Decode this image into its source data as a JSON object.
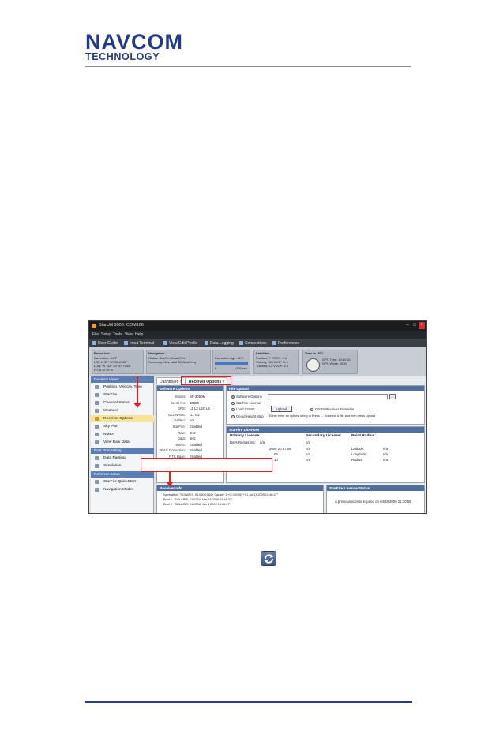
{
  "header": {
    "logo_main": "NAVCOM",
    "logo_sub": "TECHNOLOGY"
  },
  "colors": {
    "brand": "#243a8c",
    "highlight": "#e02020",
    "panel_header": "#4f6f9f"
  },
  "screenshot": {
    "window_title": "StarUtil 3000: COM106",
    "menu": [
      "File",
      "Setup",
      "Tools",
      "View",
      "Help"
    ],
    "toolbar": [
      "User Guide",
      "Input Terminal",
      "View/Edit Profile",
      "Data Logging",
      "Connections",
      "Preferences"
    ],
    "status": {
      "rover_info": {
        "title": "Rover Info",
        "line1": "Correction: NCT",
        "line2": "LAT: N 33° 50' 28.2388\"",
        "line3": "LON: W 118° 20' 37.7934\"",
        "line4": "HT: 6.9779 m"
      },
      "navigation": {
        "title": "Navigation",
        "line1": "Status: StarFire Dual 67%",
        "line2": "Summary: Nav-valid 3D DualFreq",
        "line3": "Correction Age: 82.0",
        "line4": "0",
        "line5": "1200 sec"
      },
      "satellites": {
        "title": "Satellites",
        "line1": "Position: 7    PDOP: 2.6",
        "line2": "Velocity: 11   HDOP: 0.9",
        "line3": "Tracked: 13    VDOP: 2.0"
      },
      "time": {
        "title": "Time in UTC",
        "line1": "GPS Time: 10:40:21",
        "line2": "GPS Week: 1500"
      }
    },
    "sidebar": {
      "detailed_views_title": "Detailed Views",
      "detailed_views": [
        "Position, Velocity, Time",
        "StarFire",
        "Channel Status",
        "Measure",
        "Receiver Options",
        "Sky Plot",
        "NMEA",
        "View Raw Data"
      ],
      "post_processing_title": "Post Processing",
      "post_processing": [
        "Data Parsing",
        "Simulation"
      ],
      "receiver_setup_title": "Receiver Setup",
      "receiver_setup": [
        "StarFire QuickStart",
        "Navigation Modes"
      ]
    },
    "tabs": {
      "dashboard": "Dashboard",
      "receiver_options": "Receiver Options"
    },
    "software_options": {
      "title": "Software Options",
      "rows": [
        {
          "label": "Model:",
          "value": "SF-3050M"
        },
        {
          "label": "Serial No:",
          "value": "30006"
        },
        {
          "label": "GPS:",
          "value": "L1 L2 L2C L5"
        },
        {
          "label": "GLONASS:",
          "value": "G1 G2"
        },
        {
          "label": "Galileo:",
          "value": "n/a"
        },
        {
          "label": "StarFire:",
          "value": "Enabled"
        },
        {
          "label": "Raw:",
          "value": "5Hz"
        },
        {
          "label": "Data:",
          "value": "5Hz"
        },
        {
          "label": "SBAS:",
          "value": "Enabled"
        },
        {
          "label": "SBAS Correction:",
          "value": "Enabled"
        },
        {
          "label": "RTK Base:",
          "value": "Enabled"
        }
      ]
    },
    "file_upload": {
      "title": "File Upload",
      "opt_software": "Software Options",
      "opt_starfire": "StarFire License",
      "opt_load": "Load CGMS",
      "opt_geoid": "Geoid Height Map",
      "upload_button": "Upload",
      "opt_gnss": "GNSS Receiver Firmware",
      "hint": "Either enter an options string or Press '...' to select a file, and then press Upload"
    },
    "starfire_licenses": {
      "title": "StarFire Licenses",
      "h_primary": "Primary License:",
      "h_secondary": "Secondary License:",
      "h_point": "Point Radius:",
      "days_label": "Days Remaining:",
      "days_value": "n/a",
      "days_sec": "n/a",
      "row2_mid": "2009 20:37:08",
      "row2_sec": "n/a",
      "row2_point_label": "Latitude:",
      "row2_point_value": "n/a",
      "row3_mid": "05",
      "row3_sec": "n/a",
      "row3_point_label": "Longitude:",
      "row3_point_value": "n/a",
      "row4_mid": "10",
      "row4_sec": "n/a",
      "row4_point_label": "Radius:",
      "row4_point_value": "n/a"
    },
    "receiver_info": {
      "title": "Receiver Info",
      "line1": "Navigation: \"SOLARIS, 01.0608.064+ Gauss+ D+O.0.0/00)\"+01 Jul 17 2009 10:46:47\"",
      "line2": "Boot 1:  \"SOLARIS, 01.0234, Mar 18 2009 15:46:37\"",
      "line3": "Boot 2:  \"SOLARIS, 01.0008, Jan 4 2009 13:56:07\""
    },
    "license_status": {
      "title": "StarFire License Status",
      "message": "A previous license expired on 04/28/2009 21:30:55"
    }
  }
}
